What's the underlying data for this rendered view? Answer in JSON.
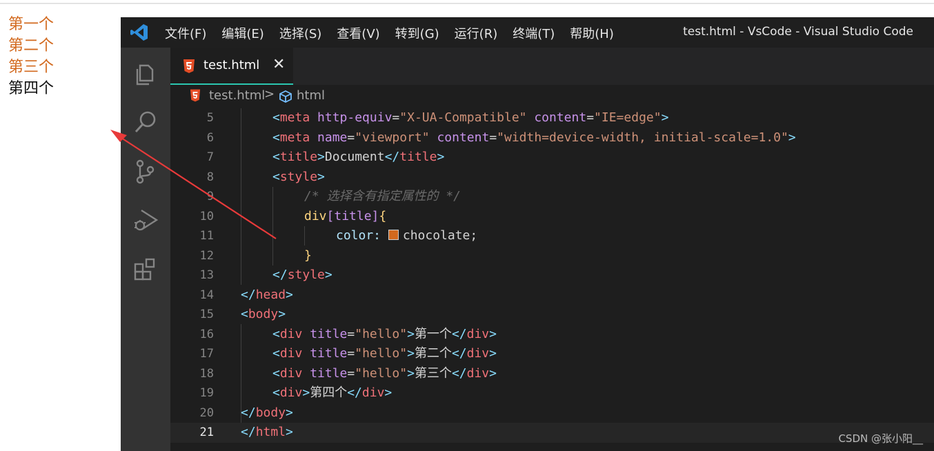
{
  "preview": {
    "items": [
      "第一个",
      "第二个",
      "第三个",
      "第四个"
    ],
    "colored_color": "#d2691e"
  },
  "titlebar": {
    "menu": [
      "文件(F)",
      "编辑(E)",
      "选择(S)",
      "查看(V)",
      "转到(G)",
      "运行(R)",
      "终端(T)",
      "帮助(H)"
    ],
    "title": "test.html - VsCode - Visual Studio Code"
  },
  "activitybar": {
    "icons": [
      "explorer-icon",
      "search-icon",
      "source-control-icon",
      "run-debug-icon",
      "extensions-icon"
    ]
  },
  "tab": {
    "name": "test.html",
    "close": "✕"
  },
  "breadcrumb": {
    "file": "test.html",
    "separator": ">",
    "symbol": "html"
  },
  "editor": {
    "lines": [
      {
        "num": "5",
        "indent": 2,
        "tokens": [
          [
            "<",
            "t-ang"
          ],
          [
            "meta",
            "t-tagred"
          ],
          [
            " http-equiv",
            "t-selattr"
          ],
          [
            "=",
            "t-text"
          ],
          [
            "\"X-UA-Compatible\"",
            "t-str"
          ],
          [
            " content",
            "t-selattr"
          ],
          [
            "=",
            "t-text"
          ],
          [
            "\"IE=edge\"",
            "t-str"
          ],
          [
            ">",
            "t-ang"
          ]
        ]
      },
      {
        "num": "6",
        "indent": 2,
        "tokens": [
          [
            "<",
            "t-ang"
          ],
          [
            "meta",
            "t-tagred"
          ],
          [
            " name",
            "t-selattr"
          ],
          [
            "=",
            "t-text"
          ],
          [
            "\"viewport\"",
            "t-str"
          ],
          [
            " content",
            "t-selattr"
          ],
          [
            "=",
            "t-text"
          ],
          [
            "\"width=device-width, initial-scale=1.0\"",
            "t-str"
          ],
          [
            ">",
            "t-ang"
          ]
        ]
      },
      {
        "num": "7",
        "indent": 2,
        "tokens": [
          [
            "<",
            "t-ang"
          ],
          [
            "title",
            "t-tagred"
          ],
          [
            ">",
            "t-ang"
          ],
          [
            "Document",
            "t-text"
          ],
          [
            "</",
            "t-ang"
          ],
          [
            "title",
            "t-tagred"
          ],
          [
            ">",
            "t-ang"
          ]
        ]
      },
      {
        "num": "8",
        "indent": 2,
        "tokens": [
          [
            "<",
            "t-ang"
          ],
          [
            "style",
            "t-tagred"
          ],
          [
            ">",
            "t-ang"
          ]
        ]
      },
      {
        "num": "9",
        "indent": 4,
        "tokens": [
          [
            "/* 选择含有指定属性的 */",
            "t-comment"
          ]
        ]
      },
      {
        "num": "10",
        "indent": 4,
        "tokens": [
          [
            "div",
            "t-sel"
          ],
          [
            "[",
            "t-brk"
          ],
          [
            "title",
            "t-selattr"
          ],
          [
            "]",
            "t-brk"
          ],
          [
            "{",
            "t-sel"
          ]
        ]
      },
      {
        "num": "11",
        "indent": 6,
        "tokens": [
          [
            "color: ",
            "t-prop"
          ],
          [
            "SWATCH",
            "swatch"
          ],
          [
            "chocolate",
            "t-text"
          ],
          [
            ";",
            "t-text"
          ]
        ]
      },
      {
        "num": "12",
        "indent": 4,
        "tokens": [
          [
            "}",
            "t-sel"
          ]
        ]
      },
      {
        "num": "13",
        "indent": 2,
        "tokens": [
          [
            "</",
            "t-ang"
          ],
          [
            "style",
            "t-tagred"
          ],
          [
            ">",
            "t-ang"
          ]
        ]
      },
      {
        "num": "14",
        "indent": 0,
        "tokens": [
          [
            "</",
            "t-ang"
          ],
          [
            "head",
            "t-tagred"
          ],
          [
            ">",
            "t-ang"
          ]
        ]
      },
      {
        "num": "15",
        "indent": 0,
        "tokens": [
          [
            "<",
            "t-ang"
          ],
          [
            "body",
            "t-tagred"
          ],
          [
            ">",
            "t-ang"
          ]
        ]
      },
      {
        "num": "16",
        "indent": 2,
        "tokens": [
          [
            "<",
            "t-ang"
          ],
          [
            "div",
            "t-tagred"
          ],
          [
            " title",
            "t-selattr"
          ],
          [
            "=",
            "t-text"
          ],
          [
            "\"hello\"",
            "t-str"
          ],
          [
            ">",
            "t-ang"
          ],
          [
            "第一个",
            "t-text"
          ],
          [
            "</",
            "t-ang"
          ],
          [
            "div",
            "t-tagred"
          ],
          [
            ">",
            "t-ang"
          ]
        ]
      },
      {
        "num": "17",
        "indent": 2,
        "tokens": [
          [
            "<",
            "t-ang"
          ],
          [
            "div",
            "t-tagred"
          ],
          [
            " title",
            "t-selattr"
          ],
          [
            "=",
            "t-text"
          ],
          [
            "\"hello\"",
            "t-str"
          ],
          [
            ">",
            "t-ang"
          ],
          [
            "第二个",
            "t-text"
          ],
          [
            "</",
            "t-ang"
          ],
          [
            "div",
            "t-tagred"
          ],
          [
            ">",
            "t-ang"
          ]
        ]
      },
      {
        "num": "18",
        "indent": 2,
        "tokens": [
          [
            "<",
            "t-ang"
          ],
          [
            "div",
            "t-tagred"
          ],
          [
            " title",
            "t-selattr"
          ],
          [
            "=",
            "t-text"
          ],
          [
            "\"hello\"",
            "t-str"
          ],
          [
            ">",
            "t-ang"
          ],
          [
            "第三个",
            "t-text"
          ],
          [
            "</",
            "t-ang"
          ],
          [
            "div",
            "t-tagred"
          ],
          [
            ">",
            "t-ang"
          ]
        ]
      },
      {
        "num": "19",
        "indent": 2,
        "tokens": [
          [
            "<",
            "t-ang"
          ],
          [
            "div",
            "t-tagred"
          ],
          [
            ">",
            "t-ang"
          ],
          [
            "第四个",
            "t-text"
          ],
          [
            "</",
            "t-ang"
          ],
          [
            "div",
            "t-tagred"
          ],
          [
            ">",
            "t-ang"
          ]
        ]
      },
      {
        "num": "20",
        "indent": 0,
        "tokens": [
          [
            "</",
            "t-ang"
          ],
          [
            "body",
            "t-tagred"
          ],
          [
            ">",
            "t-ang"
          ]
        ]
      },
      {
        "num": "21",
        "indent": 0,
        "current": true,
        "tokens": [
          [
            "</",
            "t-ang"
          ],
          [
            "html",
            "t-tagred"
          ],
          [
            ">",
            "t-ang"
          ]
        ]
      }
    ],
    "swatch_color": "#d2691e"
  },
  "watermark": "CSDN @张小阳__"
}
